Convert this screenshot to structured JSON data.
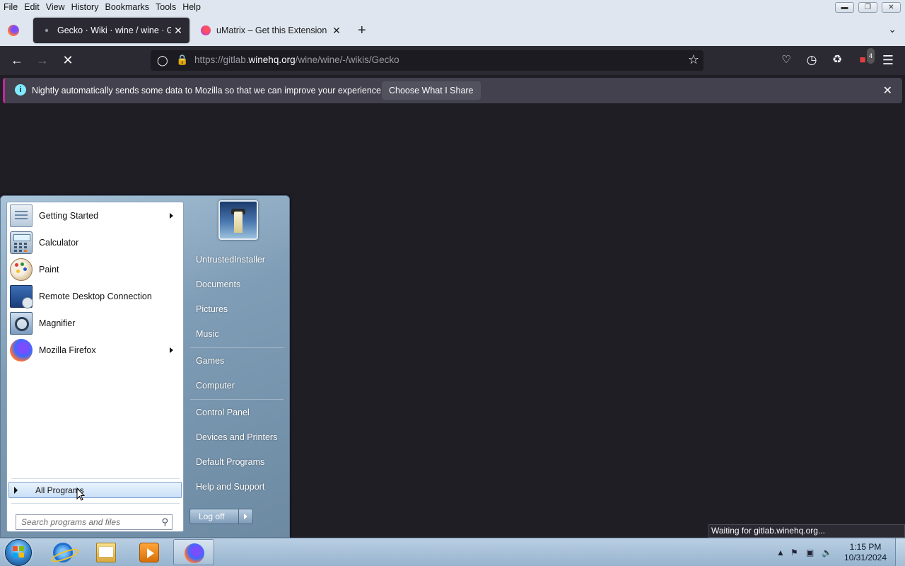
{
  "menubar": {
    "items": [
      {
        "label": "File"
      },
      {
        "label": "Edit"
      },
      {
        "label": "View"
      },
      {
        "label": "History"
      },
      {
        "label": "Bookmarks"
      },
      {
        "label": "Tools"
      },
      {
        "label": "Help"
      }
    ]
  },
  "tabs": [
    {
      "title": "Gecko · Wiki · wine / wine · GitLab",
      "active": true
    },
    {
      "title": "uMatrix – Get this Extension for Firefox",
      "active": false
    }
  ],
  "navbar": {
    "url_prefix": "https://gitlab.",
    "url_domain": "winehq.org",
    "url_path": "/wine/wine/-/wikis/Gecko",
    "extension_badge": "4"
  },
  "notification": {
    "message": "Nightly automatically sends some data to Mozilla so that we can improve your experience.",
    "button_label": "Choose What I Share"
  },
  "status": {
    "text": "Waiting for gitlab.winehq.org..."
  },
  "start_menu": {
    "programs": [
      {
        "label": "Getting Started",
        "icon": "getting-started-icon",
        "has_submenu": true
      },
      {
        "label": "Calculator",
        "icon": "calculator-icon",
        "has_submenu": false
      },
      {
        "label": "Paint",
        "icon": "paint-icon",
        "has_submenu": false
      },
      {
        "label": "Remote Desktop Connection",
        "icon": "remote-desktop-icon",
        "has_submenu": false
      },
      {
        "label": "Magnifier",
        "icon": "magnifier-icon",
        "has_submenu": false
      },
      {
        "label": "Mozilla Firefox",
        "icon": "firefox-icon",
        "has_submenu": true
      }
    ],
    "all_programs_label": "All Programs",
    "search_placeholder": "Search programs and files",
    "right_items": [
      {
        "label": "UntrustedInstaller"
      },
      {
        "label": "Documents"
      },
      {
        "label": "Pictures"
      },
      {
        "label": "Music"
      },
      {
        "label": "Games"
      },
      {
        "label": "Computer"
      },
      {
        "label": "Control Panel"
      },
      {
        "label": "Devices and Printers"
      },
      {
        "label": "Default Programs"
      },
      {
        "label": "Help and Support"
      }
    ],
    "logoff_label": "Log off"
  },
  "taskbar": {
    "pinned": [
      {
        "icon": "internet-explorer-icon"
      },
      {
        "icon": "file-explorer-icon"
      },
      {
        "icon": "media-player-icon"
      },
      {
        "icon": "firefox-icon",
        "active": true
      }
    ],
    "clock_time": "1:15 PM",
    "clock_date": "10/31/2024"
  }
}
